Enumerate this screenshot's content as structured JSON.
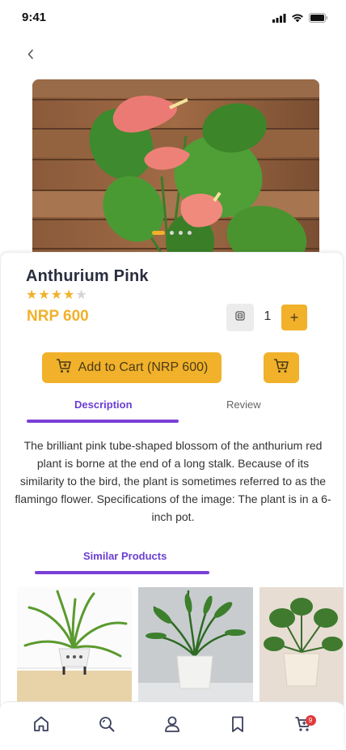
{
  "status_bar": {
    "time": "9:41",
    "icons": [
      "cellular-signal-icon",
      "wifi-icon",
      "battery-icon"
    ]
  },
  "nav": {
    "back_icon": "chevron-left-icon"
  },
  "product": {
    "name": "Anthurium Pink",
    "rating": 4,
    "rating_max": 5,
    "price": "NRP 600",
    "quantity": "1",
    "image_index": 1,
    "image_count": 4
  },
  "actions": {
    "add_to_cart_label": "Add to Cart (NRP 600)",
    "plus_label": "+"
  },
  "tabs": {
    "description": "Description",
    "review": "Review",
    "active": "description"
  },
  "description": "The brilliant pink tube-shaped blossom of the anthurium red plant is borne at the end of a long stalk. Because of its similarity to the bird, the plant is sometimes referred to as the flamingo flower. Specifications of the image: The plant is in a 6-inch pot.",
  "similar": {
    "label": "Similar Products",
    "items": [
      {
        "image": "spider-plant-photo"
      },
      {
        "image": "palm-plant-photo"
      },
      {
        "image": "monstera-plant-photo"
      }
    ]
  },
  "bottom_nav": {
    "items": [
      "home-icon",
      "search-icon",
      "profile-icon",
      "bookmark-icon",
      "cart-icon"
    ],
    "cart_count": "9"
  },
  "colors": {
    "accent": "#f1b12b",
    "tab_active": "#7a3fd6",
    "badge": "#e03a3a"
  }
}
